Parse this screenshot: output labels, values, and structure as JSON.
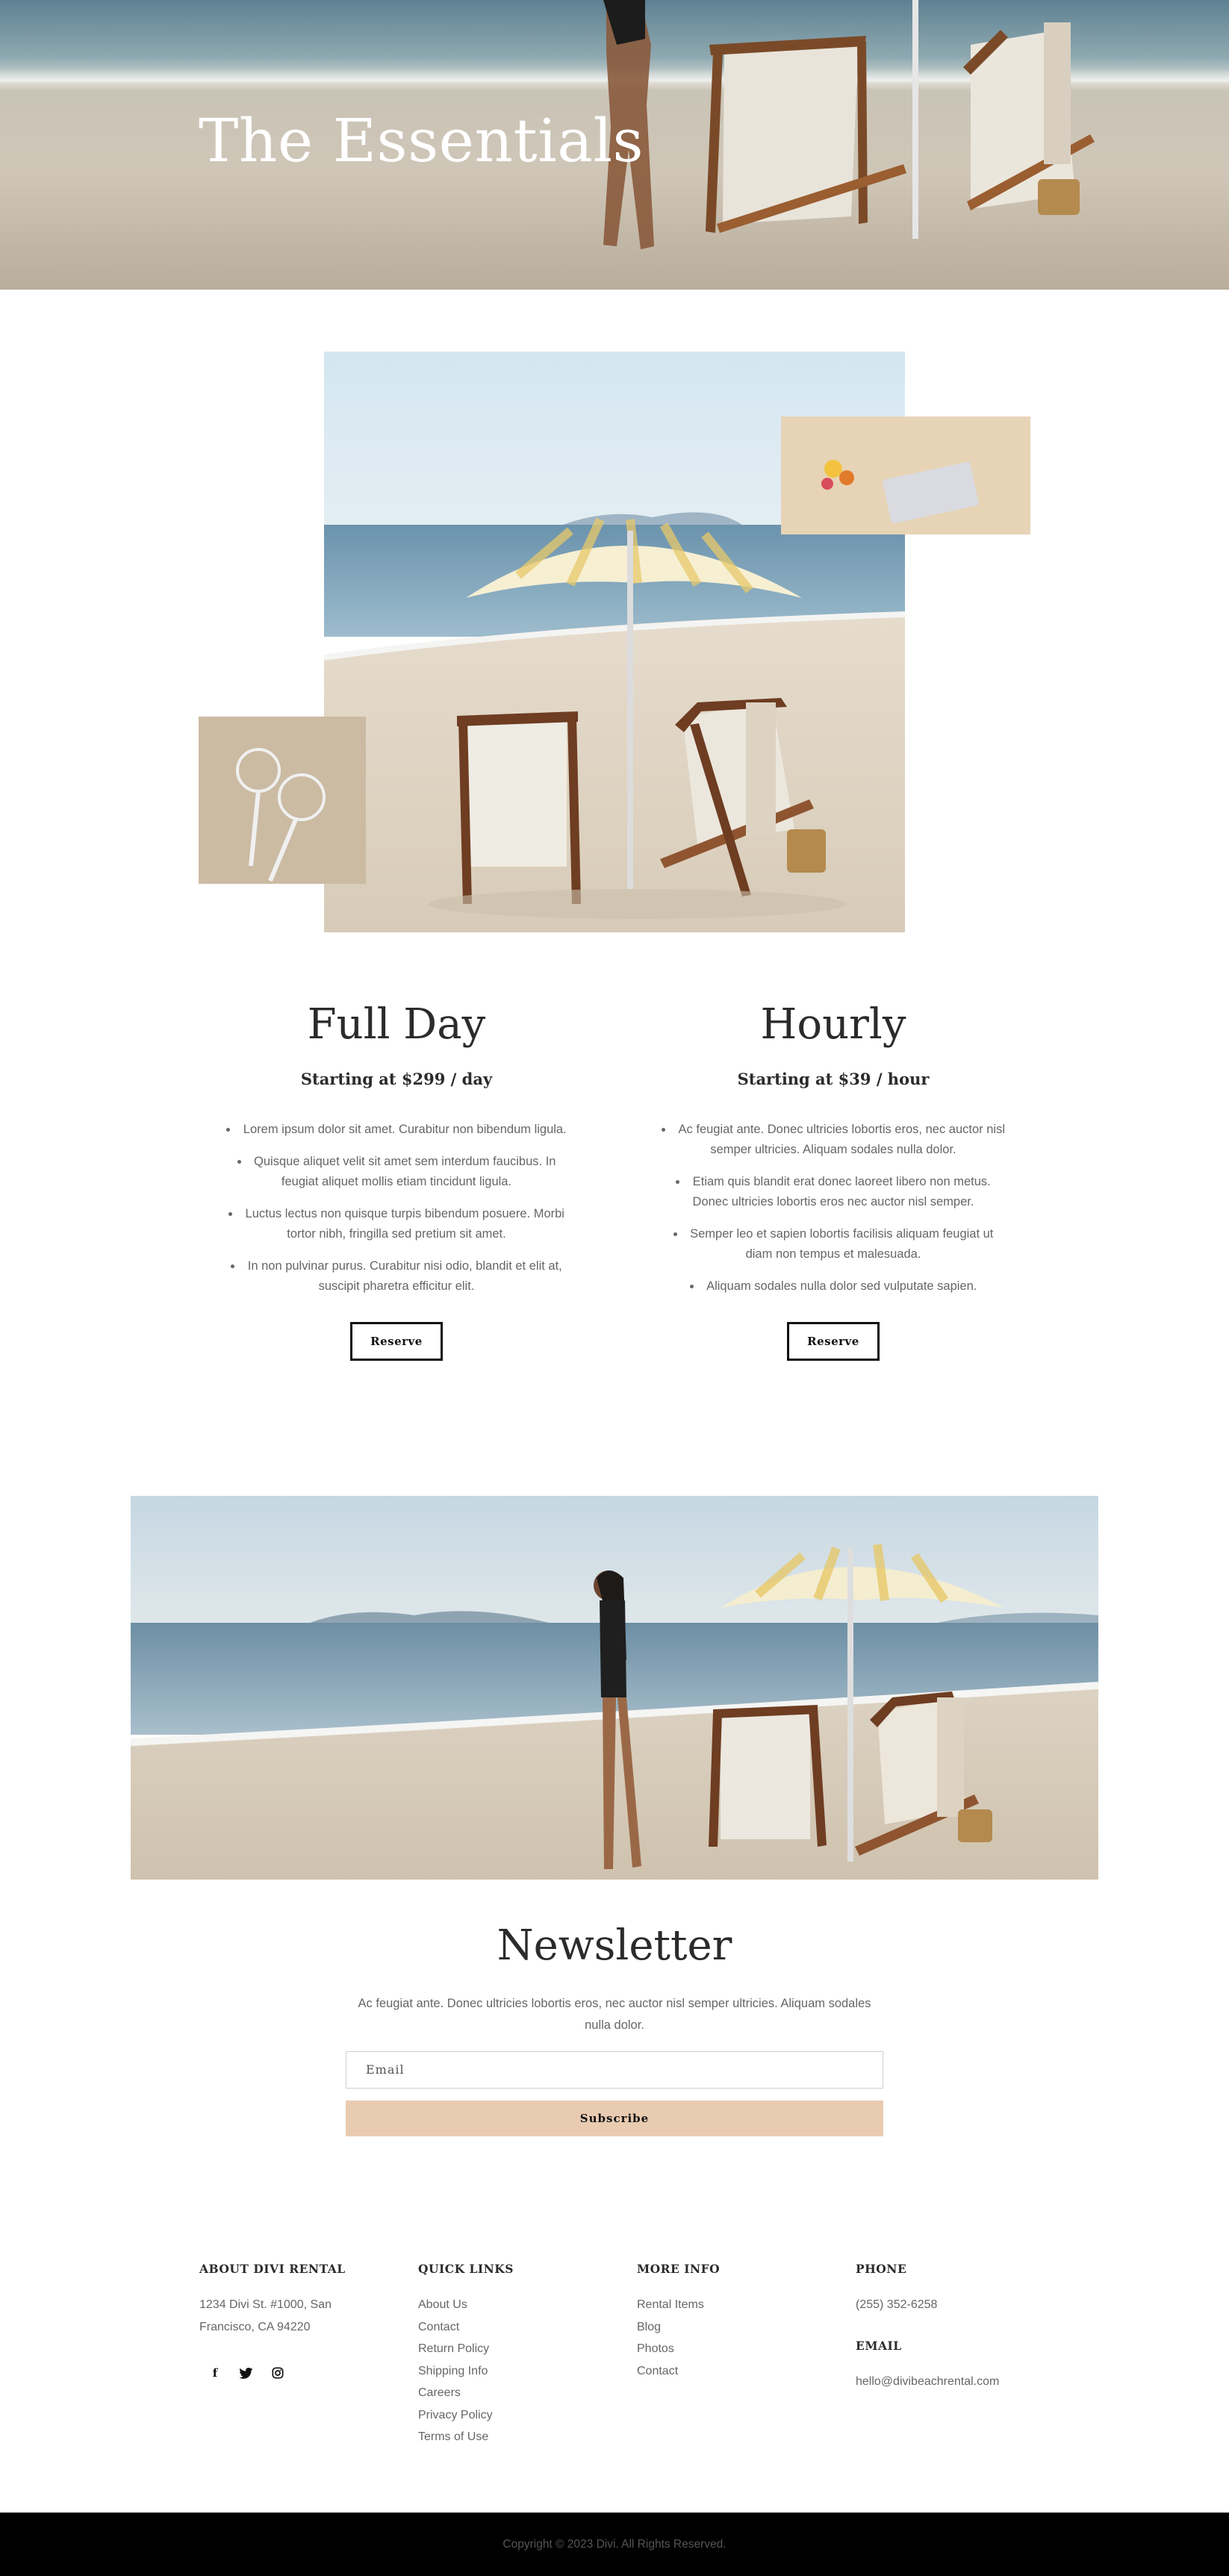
{
  "hero": {
    "title": "The Essentials"
  },
  "plans": [
    {
      "title": "Full Day",
      "price": "Starting at $299 / day",
      "features": [
        "Lorem ipsum dolor sit amet. Curabitur non bibendum ligula.",
        "Quisque aliquet velit sit amet sem interdum faucibus. In feugiat aliquet mollis etiam tincidunt ligula.",
        "Luctus lectus non quisque turpis bibendum posuere. Morbi tortor nibh, fringilla sed pretium sit amet.",
        "In non pulvinar purus. Curabitur nisi odio, blandit et elit at, suscipit pharetra efficitur elit."
      ],
      "button": "Reserve"
    },
    {
      "title": "Hourly",
      "price": "Starting at $39 / hour",
      "features": [
        "Ac feugiat ante. Donec ultricies lobortis eros, nec auctor nisl semper ultricies. Aliquam sodales nulla dolor.",
        "Etiam quis blandit erat donec laoreet libero non metus. Donec ultricies lobortis eros nec auctor nisl semper.",
        "Semper leo et sapien lobortis facilisis aliquam feugiat ut diam non tempus et malesuada.",
        "Aliquam sodales nulla dolor sed vulputate sapien."
      ],
      "button": "Reserve"
    }
  ],
  "newsletter": {
    "title": "Newsletter",
    "text": "Ac feugiat ante. Donec ultricies lobortis eros, nec auctor nisl semper ultricies. Aliquam sodales nulla dolor.",
    "email_placeholder": "Email",
    "button": "Subscribe",
    "button_color": "#e9cbb1"
  },
  "footer": {
    "about": {
      "heading": "ABOUT DIVI RENTAL",
      "address_line1": "1234 Divi St. #1000, San",
      "address_line2": "Francisco, CA 94220",
      "social": [
        "facebook-icon",
        "twitter-icon",
        "instagram-icon"
      ]
    },
    "quick_links": {
      "heading": "QUICK LINKS",
      "items": [
        "About Us",
        "Contact",
        "Return Policy",
        "Shipping Info",
        "Careers",
        "Privacy Policy",
        "Terms of Use"
      ]
    },
    "more_info": {
      "heading": "MORE INFO",
      "items": [
        "Rental Items",
        "Blog",
        "Photos",
        "Contact"
      ]
    },
    "contact": {
      "phone_heading": "PHONE",
      "phone": "(255) 352-6258",
      "email_heading": "EMAIL",
      "email": "hello@divibeachrental.com"
    },
    "copyright": "Copyright © 2023 Divi. All Rights Reserved."
  }
}
